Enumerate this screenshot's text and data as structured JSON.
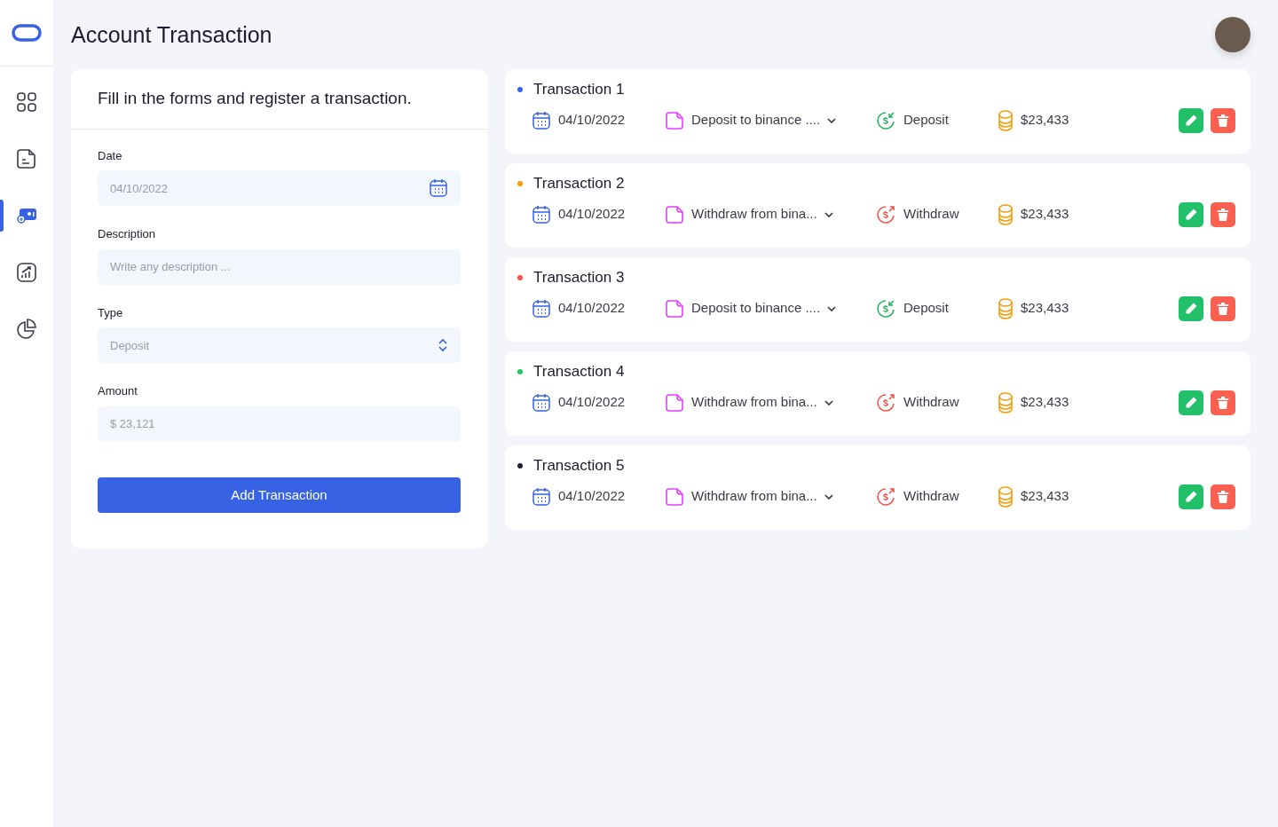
{
  "sidebar": {
    "items": [
      {
        "kind": "grid",
        "selected": false
      },
      {
        "kind": "note",
        "selected": false
      },
      {
        "kind": "wallet",
        "selected": true
      },
      {
        "kind": "chart",
        "selected": false
      },
      {
        "kind": "pie",
        "selected": false
      }
    ]
  },
  "header": {
    "title": "Account Transaction"
  },
  "form": {
    "heading": "Fill in the forms and register a transaction.",
    "fields": [
      {
        "kind": "date",
        "label": "Date",
        "placeholder": "04/10/2022"
      },
      {
        "kind": "text",
        "label": "Description",
        "placeholder": "Write any description ..."
      },
      {
        "kind": "select",
        "label": "Type",
        "placeholder": "Deposit"
      },
      {
        "kind": "text",
        "label": "Amount",
        "placeholder": "$ 23,121"
      }
    ],
    "submit": "Add Transaction"
  },
  "transactions": [
    {
      "title": "Transaction 1",
      "color": "#3662e3",
      "date": "04/10/2022",
      "description": "Deposit to binance ....",
      "kind": "deposit",
      "type": "Deposit",
      "amount": "$23,433"
    },
    {
      "title": "Transaction 2",
      "color": "#f59e0b",
      "date": "04/10/2022",
      "description": "Withdraw from bina...",
      "kind": "withdraw",
      "type": "Withdraw",
      "amount": "$23,433"
    },
    {
      "title": "Transaction 3",
      "color": "#f0524a",
      "date": "04/10/2022",
      "description": "Deposit to binance ....",
      "kind": "deposit",
      "type": "Deposit",
      "amount": "$23,433"
    },
    {
      "title": "Transaction 4",
      "color": "#22c55e",
      "date": "04/10/2022",
      "description": "Withdraw from bina...",
      "kind": "withdraw",
      "type": "Withdraw",
      "amount": "$23,433"
    },
    {
      "title": "Transaction 5",
      "color": "#1e1e2e",
      "date": "04/10/2022",
      "description": "Withdraw from bina...",
      "kind": "withdraw",
      "type": "Withdraw",
      "amount": "$23,433"
    }
  ]
}
